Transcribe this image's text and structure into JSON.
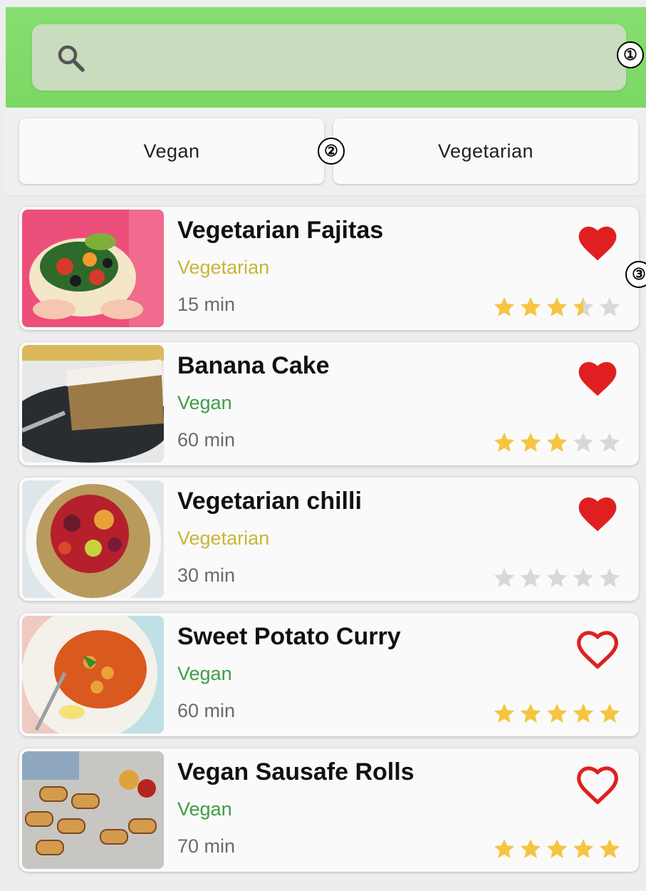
{
  "search": {
    "placeholder": "",
    "value": ""
  },
  "markers": [
    "①",
    "②",
    "③"
  ],
  "filters": [
    {
      "label": "Vegan"
    },
    {
      "label": "Vegetarian"
    }
  ],
  "colors": {
    "header_green": "#7cd764",
    "heart_red": "#e02020",
    "star_gold": "#f5c542",
    "star_empty": "#d8d8d8",
    "vegetarian": "#c9b43a",
    "vegan": "#3f9d46"
  },
  "recipes": [
    {
      "title": "Vegetarian Fajitas",
      "category": "Vegetarian",
      "time": "15 min",
      "favorite": true,
      "rating": 3.5,
      "image": "fajitas-photo"
    },
    {
      "title": "Banana Cake",
      "category": "Vegan",
      "time": "60 min",
      "favorite": true,
      "rating": 3,
      "image": "banana-cake-photo"
    },
    {
      "title": "Vegetarian chilli",
      "category": "Vegetarian",
      "time": "30 min",
      "favorite": true,
      "rating": 0,
      "image": "chilli-photo"
    },
    {
      "title": "Sweet Potato Curry",
      "category": "Vegan",
      "time": "60 min",
      "favorite": false,
      "rating": 5,
      "image": "curry-photo"
    },
    {
      "title": "Vegan Sausafe Rolls",
      "category": "Vegan",
      "time": "70 min",
      "favorite": false,
      "rating": 5,
      "image": "sausage-rolls-photo"
    }
  ]
}
